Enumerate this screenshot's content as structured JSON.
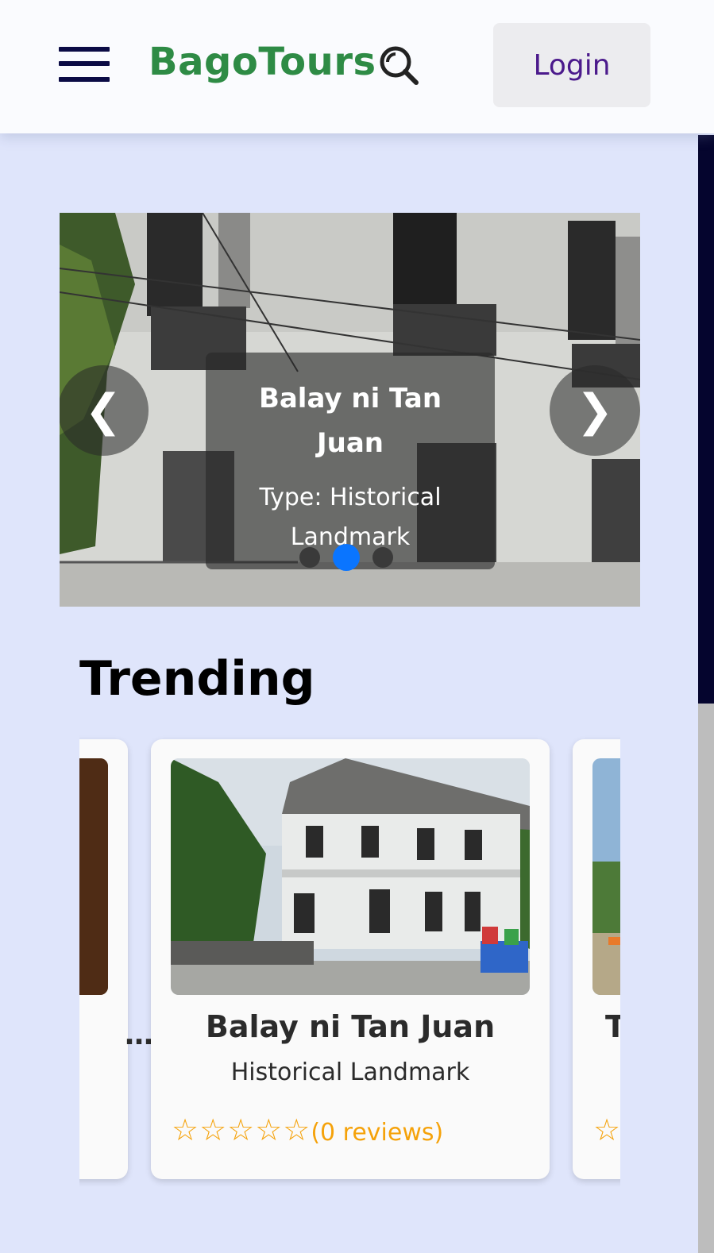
{
  "header": {
    "brand": "BagoTours",
    "login_label": "Login"
  },
  "carousel": {
    "title": "Balay ni Tan Juan",
    "type_line": "Type: Historical Landmark",
    "prev_glyph": "❮",
    "next_glyph": "❯",
    "slide_count": 3,
    "active_index": 1
  },
  "trending": {
    "heading": "Trending",
    "cards": [
      {
        "name": "…",
        "truncated": true
      },
      {
        "name": "Balay ni Tan Juan",
        "type": "Historical Landmark",
        "stars": "☆☆☆☆☆",
        "reviews": "(0 reviews)"
      },
      {
        "name": "T",
        "stars": "☆",
        "truncated": true
      }
    ]
  },
  "colors": {
    "brand_green": "#2e8b45",
    "login_text": "#4b1a8c",
    "page_bg": "#dfe5fb",
    "active_dot": "#0a75ff",
    "star": "#f5a20a"
  },
  "icons": [
    "hamburger-menu-icon",
    "search-icon",
    "chevron-left-icon",
    "chevron-right-icon",
    "star-outline-icon"
  ]
}
